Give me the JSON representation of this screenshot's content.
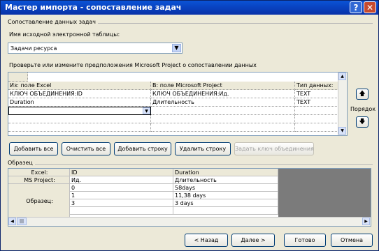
{
  "window": {
    "title": "Мастер импорта - сопоставление задач",
    "help": "?",
    "close": "✕"
  },
  "mapping": {
    "group_label": "Сопоставление данных задач",
    "source_label": "Имя исходной электронной таблицы:",
    "source_value": "Задачи ресурса",
    "verify_label": "Проверьте или измените предположения Microsoft Project о сопоставлении данных",
    "columns": [
      "Из: поле Excel",
      "В: поле Microsoft Project",
      "Тип данных:"
    ],
    "rows": [
      [
        "КЛЮЧ ОБЪЕДИНЕНИЯ:ID",
        "КЛЮЧ ОБЪЕДИНЕНИЯ:Ид.",
        "TEXT"
      ],
      [
        "Duration",
        "Длительность",
        "TEXT"
      ],
      [
        "",
        "",
        ""
      ]
    ],
    "order_label": "Порядок",
    "up_icon": "🡅",
    "down_icon": "🡇"
  },
  "buttons": {
    "add_all": "Добавить все",
    "clear_all": "Очистить все",
    "add_row": "Добавить строку",
    "delete_row": "Удалить строку",
    "merge_key": "Задать ключ объединения"
  },
  "sample": {
    "group_label": "Образец",
    "row_labels": [
      "Excel:",
      "MS Project:",
      "Образец:"
    ],
    "col1": [
      "ID",
      "Ид.",
      "0",
      "1",
      "3"
    ],
    "col2": [
      "Duration",
      "Длительность",
      "58days",
      "11,38 days",
      "3 days"
    ]
  },
  "footer": {
    "back": "< Назад",
    "next": "Далее >",
    "done": "Готово",
    "cancel": "Отмена"
  }
}
